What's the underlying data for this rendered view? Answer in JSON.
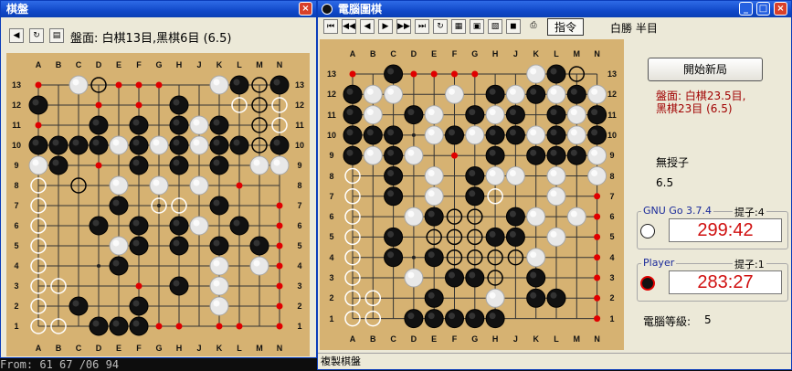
{
  "terminal": {
    "text": "From: 61 67 /06 94"
  },
  "left_window": {
    "title": "棋盤",
    "close_label": "×",
    "status": "盤面: 白棋13目,黑棋6目 (6.5)",
    "cols": [
      "A",
      "B",
      "C",
      "D",
      "E",
      "F",
      "G",
      "H",
      "J",
      "K",
      "L",
      "M",
      "N"
    ],
    "rows": [
      "13",
      "12",
      "11",
      "10",
      "9",
      "8",
      "7",
      "6",
      "5",
      "4",
      "3",
      "2",
      "1"
    ],
    "board": [
      "r.Wbrrr..WBbB",
      "B..r.r.B..wbw",
      "r..B.B.BWB.bw",
      "BBBBWBWBWBBbB",
      "WB.r.B.B.B.WW",
      "w.b.W.W.W.r..",
      "w...B.ww.B..r",
      "w..B.B.BW.B.r",
      "w...WB.B.B.Br",
      "w...B....W.Wr",
      "ww...r.B.W..r",
      "w.B..B...W..r",
      "ww.BBBrr.rr.r"
    ]
  },
  "right_window": {
    "title": "電腦圍棋",
    "toolbar_command": "指令",
    "toolbar_result": "白勝 半目",
    "cols": [
      "A",
      "B",
      "C",
      "D",
      "E",
      "F",
      "G",
      "H",
      "J",
      "K",
      "L",
      "M",
      "N"
    ],
    "rows": [
      "13",
      "12",
      "11",
      "10",
      "9",
      "8",
      "7",
      "6",
      "5",
      "4",
      "3",
      "2",
      "1"
    ],
    "board": [
      "r.Brrrr..WBb.",
      "BWW..W.BWBWBW",
      "BW.BW.BWB.BWB",
      "BBB.WBWBBWBWB",
      "BWBW.r.B.BBBW",
      "w.B.W.BWW.W.W",
      "w.B.W.Bw..W.r",
      "w..WBbb.BW.Wr",
      "w.B.bbbBB.W.r",
      "w.B.BbbbbW..r",
      "w..W.BBb.B..r",
      "ww..B..W.BB.r",
      "ww.BBBBB....r"
    ],
    "new_game_button": "開始新局",
    "score_line1": "盤面: 白棋23.5目,",
    "score_line2": "黑棋23目 (6.5)",
    "handicap": "無授子",
    "komi": "6.5",
    "white_player": {
      "name": "GNU Go 3.7.4",
      "captures": "提子:4",
      "clock": "299:42"
    },
    "black_player": {
      "name": "Player",
      "captures": "提子:1",
      "clock": "283:27"
    },
    "level_label": "電腦等級:",
    "level_value": "5",
    "status_bar": "複製棋盤"
  },
  "colors": {
    "board_wood": "#D6B272",
    "black_stone": "#111111",
    "white_stone": "#E8E8E8",
    "mark_red": "#E00000",
    "clock_red": "#D01010",
    "title_blue": "#1149C9"
  },
  "icons": {
    "left_toolbar": [
      "back-icon",
      "refresh-icon",
      "board-icon"
    ],
    "right_toolbar": [
      "first-icon",
      "rewind-icon",
      "back-icon",
      "forward-icon",
      "fast-forward-icon",
      "last-icon",
      "refresh-icon",
      "grid-icon",
      "save-icon",
      "image-icon",
      "sound-icon",
      "print-icon"
    ],
    "window_controls": [
      "minimize-icon",
      "maximize-icon",
      "close-icon"
    ]
  }
}
